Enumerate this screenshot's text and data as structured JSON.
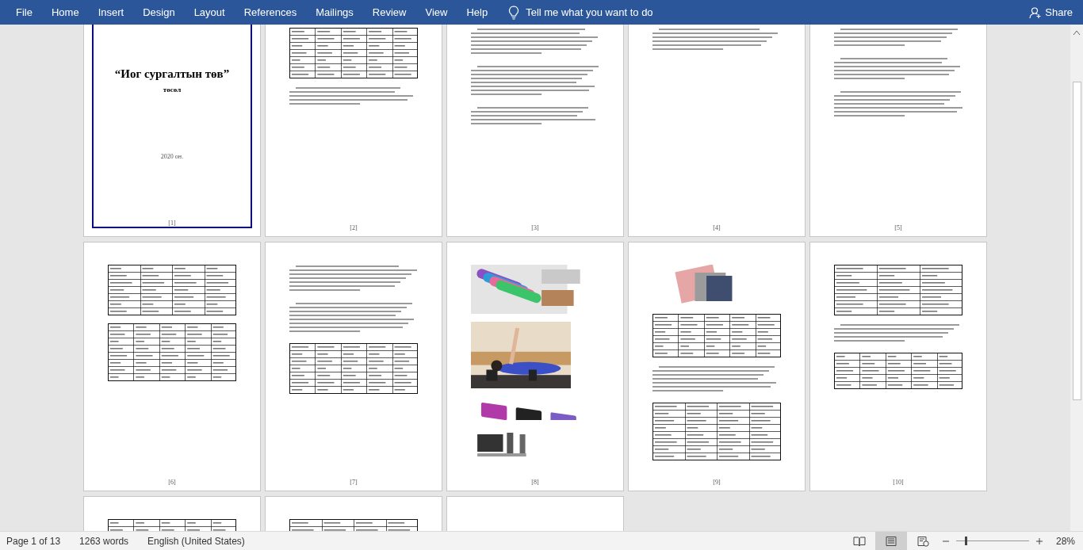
{
  "ribbon": {
    "tabs": [
      {
        "label": "File",
        "selected": false
      },
      {
        "label": "Home",
        "selected": false
      },
      {
        "label": "Insert",
        "selected": false
      },
      {
        "label": "Design",
        "selected": false
      },
      {
        "label": "Layout",
        "selected": false
      },
      {
        "label": "References",
        "selected": false
      },
      {
        "label": "Mailings",
        "selected": false
      },
      {
        "label": "Review",
        "selected": false
      },
      {
        "label": "View",
        "selected": false
      },
      {
        "label": "Help",
        "selected": false
      }
    ],
    "tell_me": "Tell me what you want to do",
    "share": "Share"
  },
  "pages": [
    {
      "kind": "cover",
      "title": "“Иог сургалтын төв”",
      "subtitle": "төсөл",
      "year": "2020 он.",
      "page_number": "[1]"
    },
    {
      "kind": "text",
      "content": [
        {
          "kind": "table"
        },
        {
          "kind": "lines"
        }
      ],
      "page_number": "[2]"
    },
    {
      "kind": "text",
      "content": [
        {
          "kind": "lines"
        },
        {
          "kind": "lines"
        },
        {
          "kind": "lines"
        }
      ],
      "page_number": "[3]"
    },
    {
      "kind": "text",
      "content": [
        {
          "kind": "lines"
        }
      ],
      "page_number": "[4]"
    },
    {
      "kind": "text",
      "content": [
        {
          "kind": "lines"
        },
        {
          "kind": "lines"
        },
        {
          "kind": "lines"
        }
      ],
      "page_number": "[5]"
    },
    {
      "kind": "text",
      "content": [
        {
          "kind": "table"
        },
        {
          "kind": "table"
        }
      ],
      "page_number": "[6]"
    },
    {
      "kind": "text",
      "content": [
        {
          "kind": "lines"
        },
        {
          "kind": "lines"
        },
        {
          "kind": "table"
        }
      ],
      "page_number": "[7]"
    },
    {
      "kind": "text",
      "content": [
        {
          "kind": "picture"
        },
        {
          "kind": "picture"
        },
        {
          "kind": "picture"
        },
        {
          "kind": "picture"
        }
      ],
      "page_number": "[8]"
    },
    {
      "kind": "text",
      "content": [
        {
          "kind": "picture"
        },
        {
          "kind": "table"
        },
        {
          "kind": "lines"
        },
        {
          "kind": "table"
        }
      ],
      "page_number": "[9]"
    },
    {
      "kind": "text",
      "content": [
        {
          "kind": "table"
        },
        {
          "kind": "lines"
        },
        {
          "kind": "table"
        }
      ],
      "page_number": "[10]"
    },
    {
      "kind": "text",
      "content": [
        {
          "kind": "table"
        }
      ]
    },
    {
      "kind": "text",
      "content": [
        {
          "kind": "table"
        }
      ]
    },
    {
      "kind": "blank"
    }
  ],
  "status_bar": {
    "page": "Page 1 of 13",
    "words": "1263 words",
    "language": "English (United States)",
    "views": [
      {
        "kind": "read",
        "selected": false
      },
      {
        "kind": "print",
        "selected": true
      },
      {
        "kind": "web",
        "selected": false
      }
    ],
    "level": 0.12,
    "zoom": "28%"
  }
}
